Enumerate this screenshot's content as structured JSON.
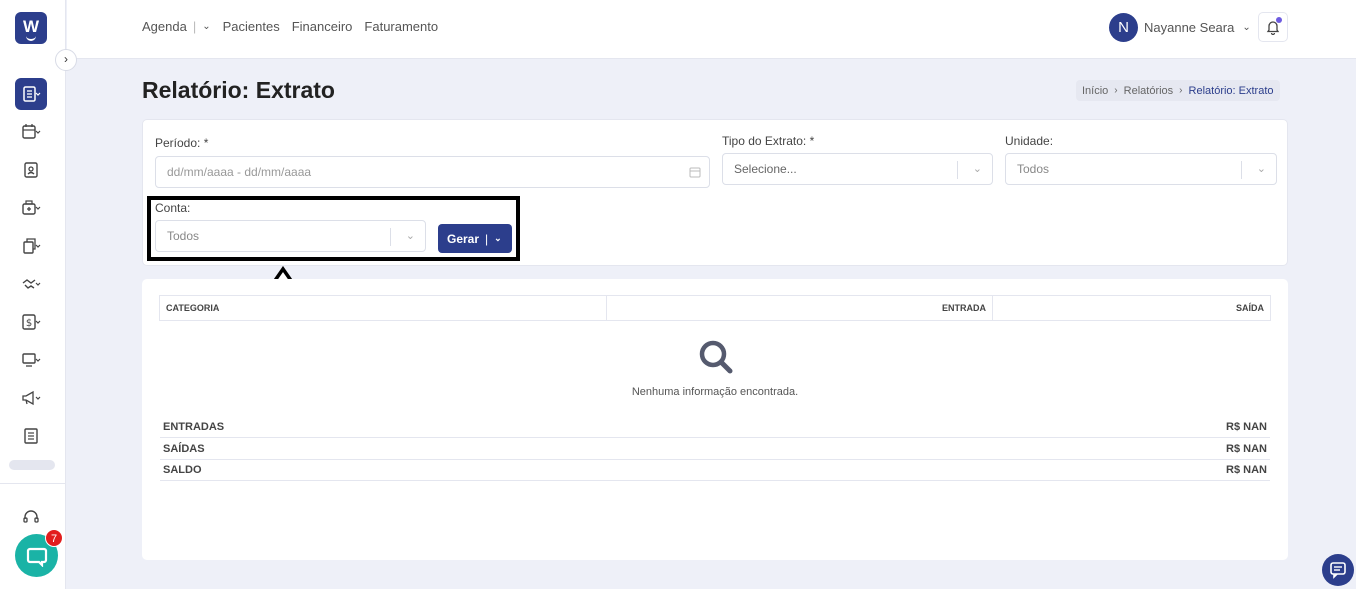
{
  "nav": {
    "agenda": "Agenda",
    "agenda_sep": "|",
    "agenda_chevron": "⌄",
    "pacientes": "Pacientes",
    "financeiro": "Financeiro",
    "faturamento": "Faturamento"
  },
  "user": {
    "initial": "N",
    "name": "Nayanne Seara",
    "chevron": "⌄"
  },
  "sidebar": {
    "collapse_glyph": "›",
    "chat_badge": "7",
    "logo_letter": "W",
    "icons": [
      "report-icon",
      "calendar-icon",
      "patient-badge-icon",
      "medical-bag-icon",
      "documents-icon",
      "handshake-icon",
      "money-icon",
      "monitor-icon",
      "megaphone-icon",
      "newspaper-icon",
      "headset-icon"
    ]
  },
  "page": {
    "title": "Relatório: Extrato"
  },
  "breadcrumb": {
    "home": "Início",
    "reports": "Relatórios",
    "current": "Relatório: Extrato",
    "separator": "›"
  },
  "filters": {
    "periodo_label": "Período: *",
    "periodo_placeholder": "dd/mm/aaaa - dd/mm/aaaa",
    "tipo_label": "Tipo do Extrato: *",
    "tipo_value": "Selecione...",
    "unidade_label": "Unidade:",
    "unidade_value": "Todos",
    "conta_label": "Conta:",
    "conta_value": "Todos",
    "gerar_label": "Gerar",
    "gerar_sep": "|",
    "gerar_chevron": "⌄",
    "dropdown_glyph": "⌄"
  },
  "table": {
    "col_categoria": "CATEGORIA",
    "col_entrada": "ENTRADA",
    "col_saida": "SAÍDA",
    "empty_message": "Nenhuma informação encontrada."
  },
  "summary": [
    {
      "label": "ENTRADAS",
      "value": "R$ NAN"
    },
    {
      "label": "SAÍDAS",
      "value": "R$ NAN"
    },
    {
      "label": "SALDO",
      "value": "R$ NAN"
    }
  ],
  "colors": {
    "primary": "#2c3e8c",
    "chat": "#1ab3a6",
    "badge": "#e21e1e",
    "background": "#eef0f8"
  }
}
